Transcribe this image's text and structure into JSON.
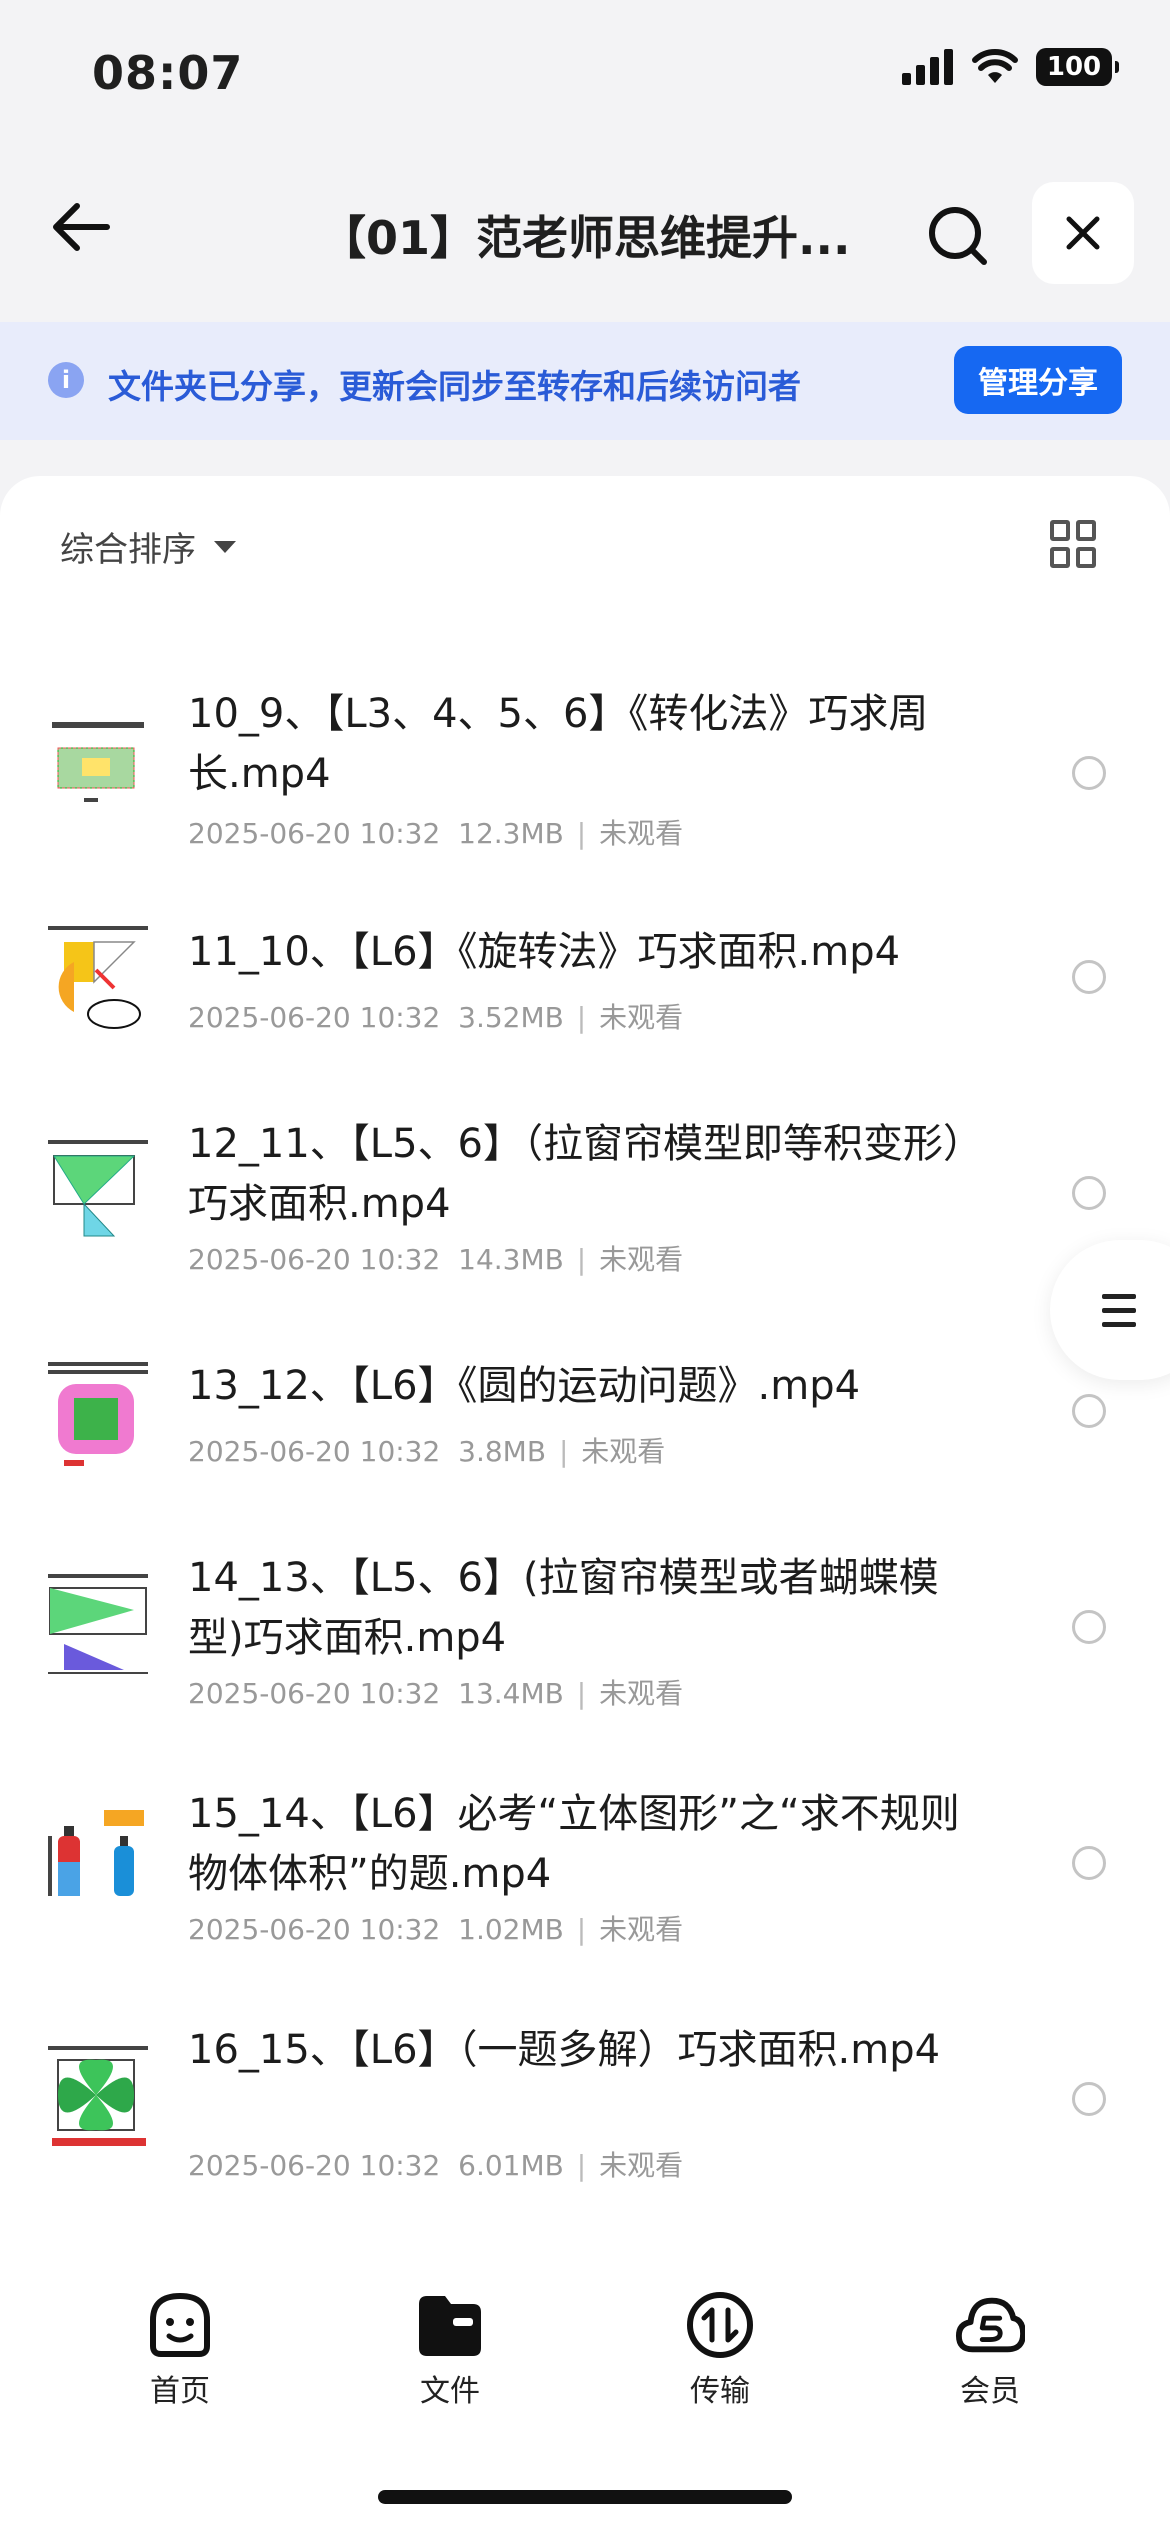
{
  "status_bar": {
    "time": "08:07",
    "battery": "100"
  },
  "header": {
    "title": "【01】范老师思维提升..."
  },
  "share_banner": {
    "text": "文件夹已分享，更新会同步至转存和后续访问者",
    "button": "管理分享"
  },
  "toolbar": {
    "sort_label": "综合排序"
  },
  "files": [
    {
      "name": "10_9、【L3、4、5、6】《转化法》巧求周长.mp4",
      "date": "2025-06-20 10:32",
      "size": "12.3MB",
      "status": "未观看"
    },
    {
      "name": "11_10、【L6】《旋转法》巧求面积.mp4",
      "date": "2025-06-20 10:32",
      "size": "3.52MB",
      "status": "未观看"
    },
    {
      "name": "12_11、【L5、6】（拉窗帘模型即等积变形）巧求面积.mp4",
      "date": "2025-06-20 10:32",
      "size": "14.3MB",
      "status": "未观看"
    },
    {
      "name": "13_12、【L6】《圆的运动问题》.mp4",
      "date": "2025-06-20 10:32",
      "size": "3.8MB",
      "status": "未观看"
    },
    {
      "name": "14_13、【L5、6】(拉窗帘模型或者蝴蝶模型)巧求面积.mp4",
      "date": "2025-06-20 10:32",
      "size": "13.4MB",
      "status": "未观看"
    },
    {
      "name": "15_14、【L6】必考“立体图形”之“求不规则物体体积”的题.mp4",
      "date": "2025-06-20 10:32",
      "size": "1.02MB",
      "status": "未观看"
    },
    {
      "name": "16_15、【L6】（一题多解）巧求面积.mp4",
      "date": "2025-06-20 10:32",
      "size": "6.01MB",
      "status": "未观看"
    }
  ],
  "bottom_nav": {
    "home": "首页",
    "files": "文件",
    "transfer": "传输",
    "vip": "会员"
  }
}
